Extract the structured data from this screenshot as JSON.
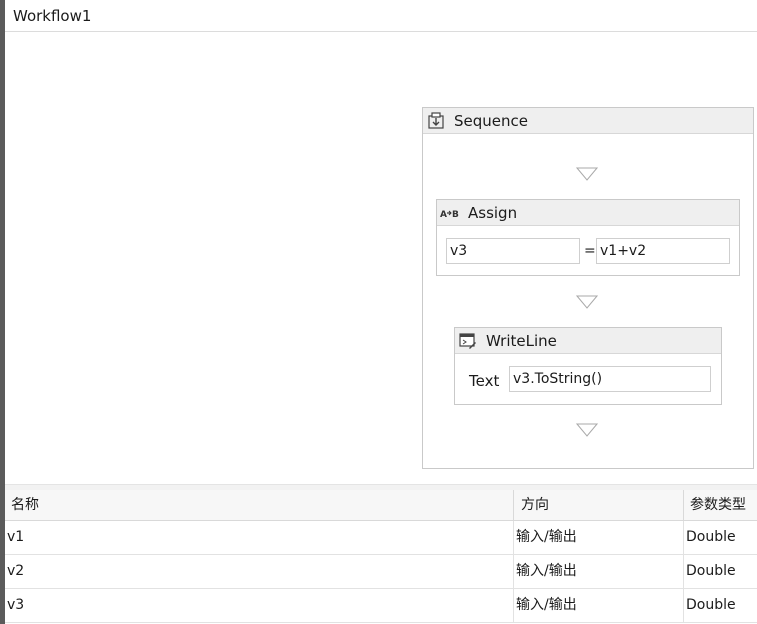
{
  "window": {
    "title": "Workflow1"
  },
  "sequence": {
    "title": "Sequence",
    "icon": "sequence-icon",
    "assign": {
      "title": "Assign",
      "icon": "assign-icon",
      "to_value": "v3",
      "operator": "=",
      "value": "v1+v2"
    },
    "writeline": {
      "title": "WriteLine",
      "icon": "writeline-icon",
      "text_label": "Text",
      "text_value": "v3.ToString()"
    }
  },
  "variables": {
    "columns": [
      "名称",
      "方向",
      "参数类型"
    ],
    "rows": [
      {
        "name": "v1",
        "direction": "输入/输出",
        "type": "Double"
      },
      {
        "name": "v2",
        "direction": "输入/输出",
        "type": "Double"
      },
      {
        "name": "v3",
        "direction": "输入/输出",
        "type": "Double"
      }
    ]
  },
  "colors": {
    "header_bg": "#efefef",
    "border": "#c9c9c9",
    "rail": "#5b5b5b"
  }
}
